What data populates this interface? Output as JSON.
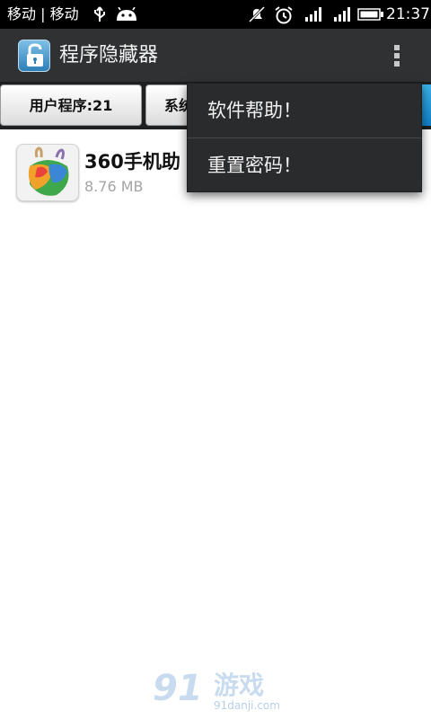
{
  "status_bar": {
    "carrier": "移动 | 移动",
    "time": "21:37",
    "icons": [
      "usb-icon",
      "android-icon",
      "mute-icon",
      "alarm-icon",
      "signal-icon",
      "signal-icon",
      "battery-icon"
    ]
  },
  "action_bar": {
    "title": "程序隐藏器",
    "app_icon": "lock-icon",
    "overflow_icon": "overflow-menu-icon"
  },
  "tabs": [
    {
      "label": "用户程序:21"
    },
    {
      "label": "系统"
    }
  ],
  "app_list": [
    {
      "name": "360手机助",
      "size": "8.76 MB",
      "icon": "360-assistant-icon"
    }
  ],
  "menu": {
    "items": [
      {
        "label": "软件帮助！"
      },
      {
        "label": "重置密码！"
      }
    ]
  },
  "watermark": {
    "number": "91",
    "text": "游戏",
    "url": "91danji.com"
  },
  "colors": {
    "action_bar_bg": "#2f3133",
    "menu_bg": "#2a2b2d",
    "tab_accent": "#1180c7"
  }
}
